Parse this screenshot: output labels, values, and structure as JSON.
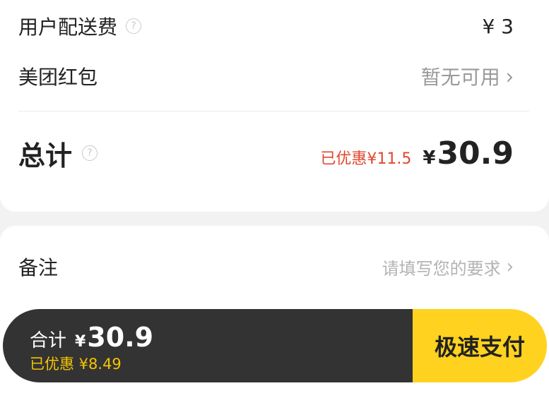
{
  "fees": {
    "delivery_label": "用户配送费",
    "delivery_value": "¥ 3",
    "redpacket_label": "美团红包",
    "redpacket_value": "暂无可用"
  },
  "total": {
    "label": "总计",
    "discount_text": "已优惠¥11.5",
    "currency": "¥",
    "amount": "30.9"
  },
  "note": {
    "label": "备注",
    "placeholder": "请填写您的要求"
  },
  "bottom_bar": {
    "total_label": "合计",
    "currency": "¥",
    "amount": "30.9",
    "discount_text": "已优惠 ¥8.49",
    "pay_button_label": "极速支付"
  },
  "icons": {
    "help": "question-mark-circle-icon",
    "chevron": "chevron-right-icon"
  },
  "colors": {
    "discount_red": "#e0482f",
    "bar_dark": "#333333",
    "pay_yellow": "#ffd21f",
    "discount_yellow": "#f5c400"
  }
}
